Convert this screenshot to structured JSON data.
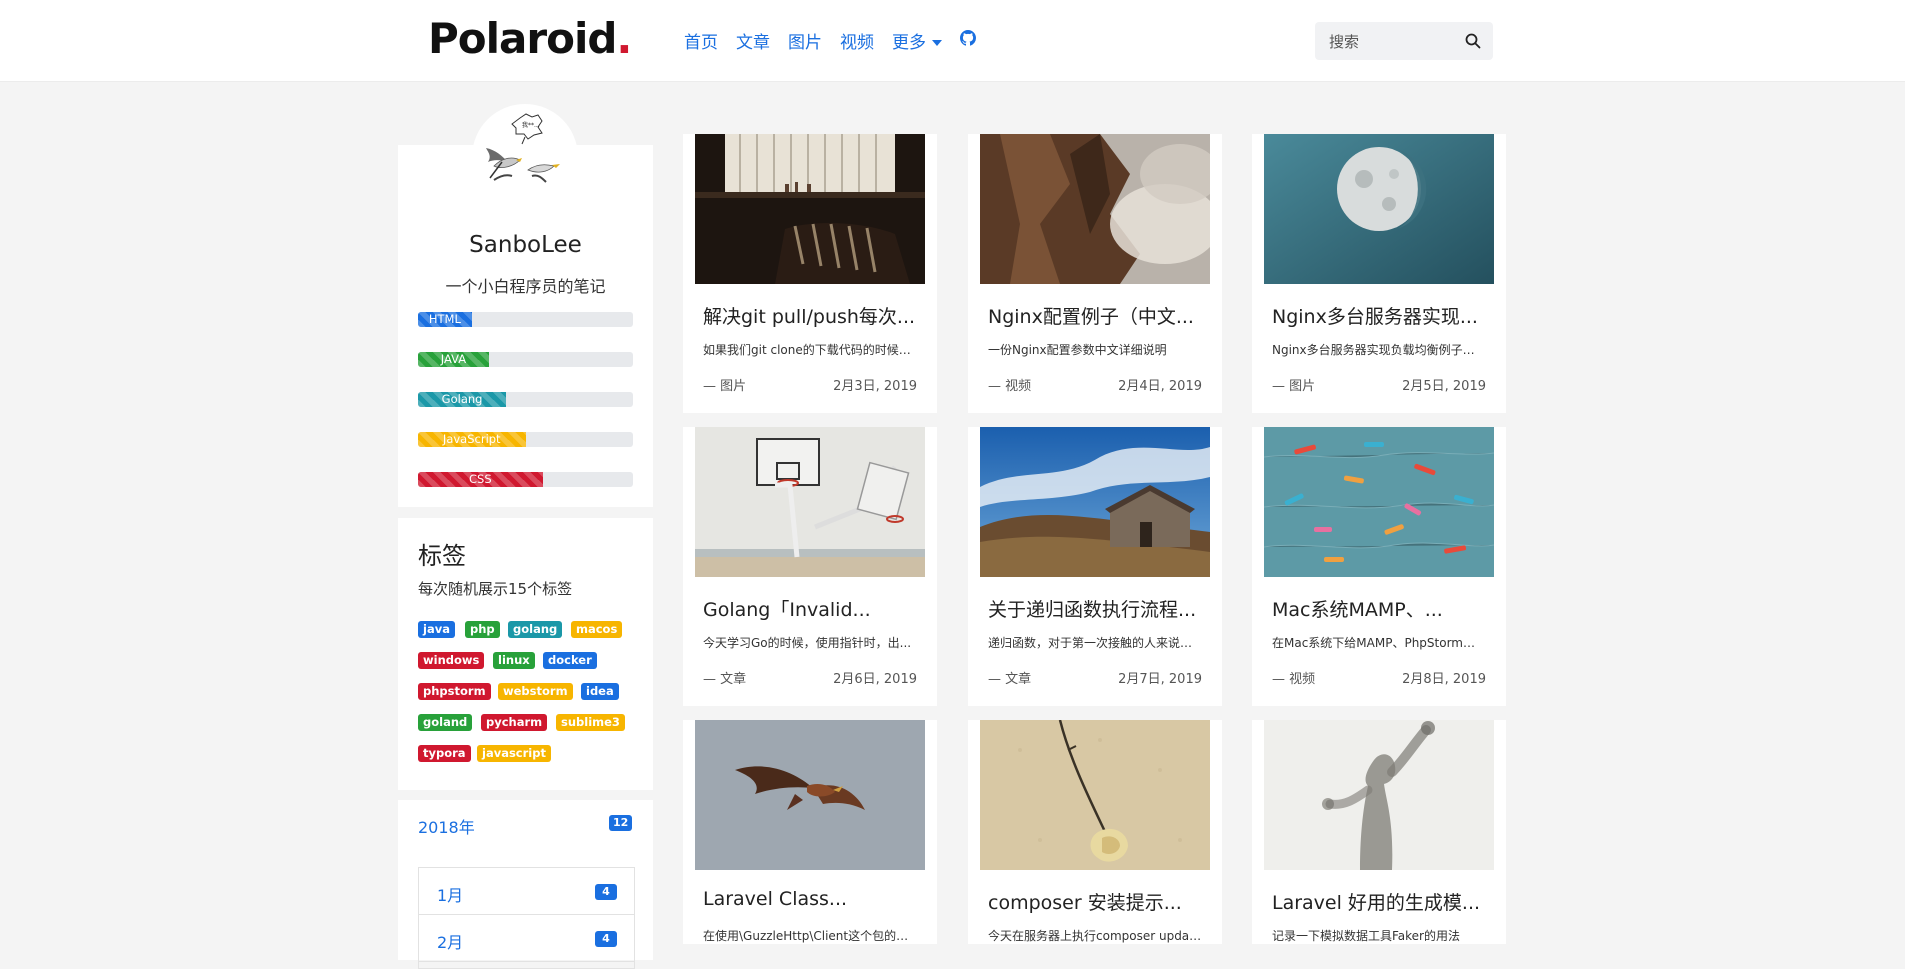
{
  "brand": {
    "name": "Polaroid",
    "dot": ".",
    "dot_color": "#d0182f"
  },
  "nav": {
    "items": [
      "首页",
      "文章",
      "图片",
      "视频"
    ],
    "more_label": "更多",
    "github_icon": "github-icon"
  },
  "search": {
    "placeholder": "搜索"
  },
  "profile": {
    "name": "SanboLee",
    "description": "一个小白程序员的笔记",
    "skills": [
      {
        "label": "HTML",
        "percent": 25,
        "color": "#1a6fe0"
      },
      {
        "label": "JAVA",
        "percent": 33,
        "color": "#28a13a"
      },
      {
        "label": "Golang",
        "percent": 41,
        "color": "#1b98a8"
      },
      {
        "label": "JavaScript",
        "percent": 50,
        "color": "#f7b500"
      },
      {
        "label": "CSS",
        "percent": 58,
        "color": "#d0182f"
      }
    ]
  },
  "tags": {
    "title": "标签",
    "description": "每次随机展示15个标签",
    "items": [
      {
        "label": "java",
        "color": "#1a6fe0"
      },
      {
        "label": "php",
        "color": "#28a13a"
      },
      {
        "label": "golang",
        "color": "#1b98a8"
      },
      {
        "label": "macos",
        "color": "#f7b500"
      },
      {
        "label": "windows",
        "color": "#d0182f"
      },
      {
        "label": "linux",
        "color": "#28a13a"
      },
      {
        "label": "docker",
        "color": "#1a6fe0"
      },
      {
        "label": "phpstorm",
        "color": "#d0182f"
      },
      {
        "label": "webstorm",
        "color": "#f7b500"
      },
      {
        "label": "idea",
        "color": "#1a6fe0"
      },
      {
        "label": "goland",
        "color": "#28a13a"
      },
      {
        "label": "pycharm",
        "color": "#d0182f"
      },
      {
        "label": "sublime3",
        "color": "#f7b500"
      },
      {
        "label": "typora",
        "color": "#d0182f"
      },
      {
        "label": "javascript",
        "color": "#f7b500"
      }
    ]
  },
  "archive": {
    "year": "2018年",
    "year_count": "12",
    "months": [
      {
        "label": "1月",
        "count": "4"
      },
      {
        "label": "2月",
        "count": "4"
      }
    ]
  },
  "posts": [
    {
      "title": "解决git pull/push每次...",
      "excerpt": "如果我们git clone的下载代码的时候是...",
      "category": "— 图片",
      "date": "2月3日, 2019"
    },
    {
      "title": "Nginx配置例子（中文...",
      "excerpt": "一份Nginx配置参数中文详细说明",
      "category": "— 视频",
      "date": "2月4日, 2019"
    },
    {
      "title": "Nginx多台服务器实现...",
      "excerpt": "Nginx多台服务器实现负载均衡例子，...",
      "category": "— 图片",
      "date": "2月5日, 2019"
    },
    {
      "title": "Golang「Invalid...",
      "excerpt": "今天学习Go的时候，使用指针时，出...",
      "category": "— 文章",
      "date": "2月6日, 2019"
    },
    {
      "title": "关于递归函数执行流程...",
      "excerpt": "递归函数，对于第一次接触的人来说，...",
      "category": "— 文章",
      "date": "2月7日, 2019"
    },
    {
      "title": "Mac系统MAMP、...",
      "excerpt": "在Mac系统下给MAMP、PhpStorm配...",
      "category": "— 视频",
      "date": "2月8日, 2019"
    },
    {
      "title": "Laravel Class...",
      "excerpt": "在使用\\GuzzleHttp\\Client这个包的时...",
      "category": "",
      "date": ""
    },
    {
      "title": "composer 安装提示...",
      "excerpt": "今天在服务器上执行composer updat...",
      "category": "",
      "date": ""
    },
    {
      "title": "Laravel 好用的生成模...",
      "excerpt": "记录一下模拟数据工具Faker的用法",
      "category": "",
      "date": ""
    }
  ]
}
